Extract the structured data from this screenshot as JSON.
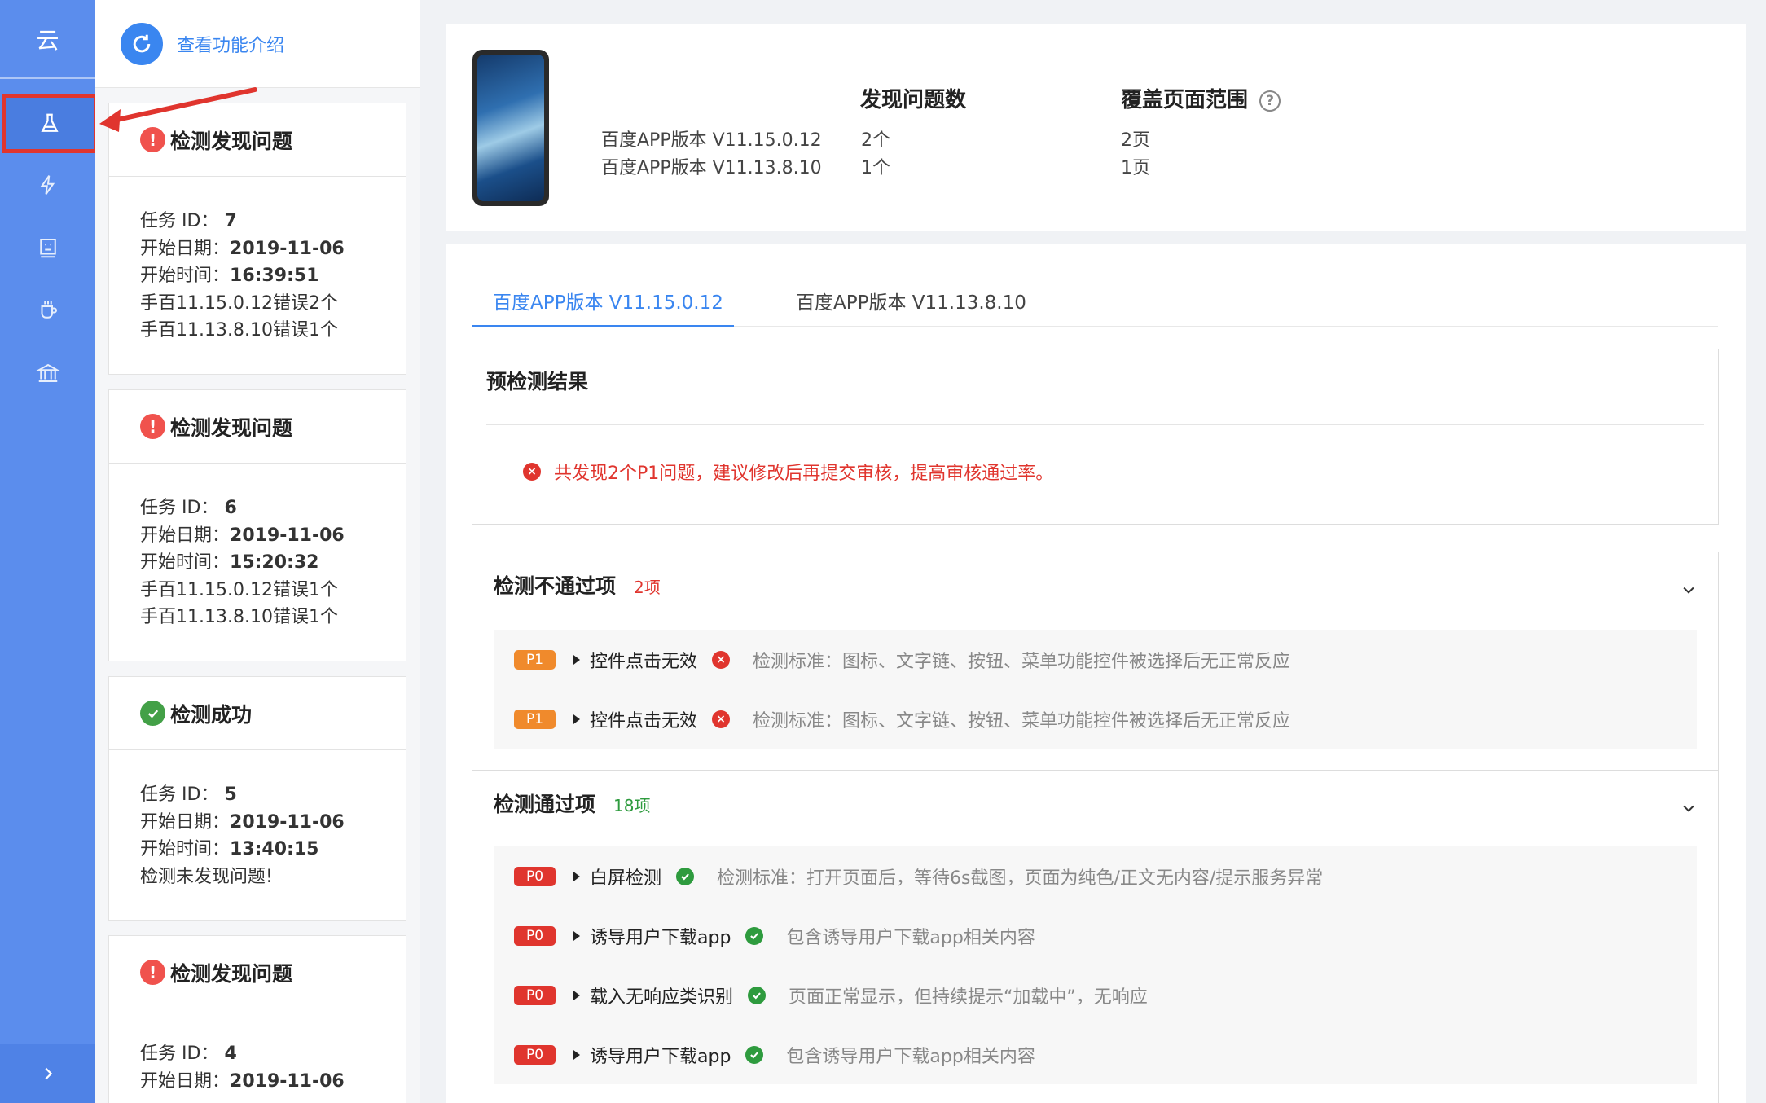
{
  "rail": {
    "brand": "云",
    "items": [
      "flask-icon",
      "bolt-icon",
      "robot-icon",
      "cup-icon",
      "bank-icon"
    ],
    "collapse": "chevron-right-icon"
  },
  "tasks": {
    "intro_link": "查看功能介绍",
    "cards": [
      {
        "status": "error",
        "title": "检测发现问题",
        "id_label": "任务 ID：",
        "id": "7",
        "date_label": "开始日期：",
        "date": "2019-11-06",
        "time_label": "开始时间：",
        "time": "16:39:51",
        "line1": "手百11.15.0.12错误2个",
        "line2": "手百11.13.8.10错误1个"
      },
      {
        "status": "error",
        "title": "检测发现问题",
        "id_label": "任务 ID：",
        "id": "6",
        "date_label": "开始日期：",
        "date": "2019-11-06",
        "time_label": "开始时间：",
        "time": "15:20:32",
        "line1": "手百11.15.0.12错误1个",
        "line2": "手百11.13.8.10错误1个"
      },
      {
        "status": "ok",
        "title": "检测成功",
        "id_label": "任务 ID：",
        "id": "5",
        "date_label": "开始日期：",
        "date": "2019-11-06",
        "time_label": "开始时间：",
        "time": "13:40:15",
        "line1": "检测未发现问题!",
        "line2": ""
      },
      {
        "status": "error",
        "title": "检测发现问题",
        "id_label": "任务 ID：",
        "id": "4",
        "date_label": "开始日期：",
        "date": "2019-11-06",
        "time_label": "",
        "time": "",
        "line1": "",
        "line2": ""
      }
    ]
  },
  "summary": {
    "issues_header": "发现问题数",
    "coverage_header": "覆盖页面范围",
    "versions": [
      "百度APP版本 V11.15.0.12",
      "百度APP版本 V11.13.8.10"
    ],
    "issues": [
      "2个",
      "1个"
    ],
    "coverage": [
      "2页",
      "1页"
    ]
  },
  "tabs": [
    "百度APP版本 V11.15.0.12",
    "百度APP版本 V11.13.8.10"
  ],
  "precheck": {
    "title": "预检测结果",
    "message": "共发现2个P1问题，建议修改后再提交审核，提高审核通过率。"
  },
  "failed": {
    "title": "检测不通过项",
    "count": "2项",
    "rows": [
      {
        "level": "P1",
        "name": "控件点击无效",
        "criteria": "检测标准：图标、文字链、按钮、菜单功能控件被选择后无正常反应"
      },
      {
        "level": "P1",
        "name": "控件点击无效",
        "criteria": "检测标准：图标、文字链、按钮、菜单功能控件被选择后无正常反应"
      }
    ]
  },
  "passed": {
    "title": "检测通过项",
    "count": "18项",
    "rows": [
      {
        "level": "P0",
        "name": "白屏检测",
        "criteria": "检测标准：打开页面后，等待6s截图，页面为纯色/正文无内容/提示服务异常"
      },
      {
        "level": "P0",
        "name": "诱导用户下载app",
        "criteria": "包含诱导用户下载app相关内容"
      },
      {
        "level": "P0",
        "name": "载入无响应类识别",
        "criteria": "页面正常显示，但持续提示“加载中”，无响应"
      },
      {
        "level": "P0",
        "name": "诱导用户下载app",
        "criteria": "包含诱导用户下载app相关内容"
      }
    ]
  },
  "colors": {
    "rail": "#5b8ded",
    "accent": "#3a86f0",
    "error": "#e0352e",
    "p1": "#f08a2c",
    "ok": "#2e9b3e"
  }
}
